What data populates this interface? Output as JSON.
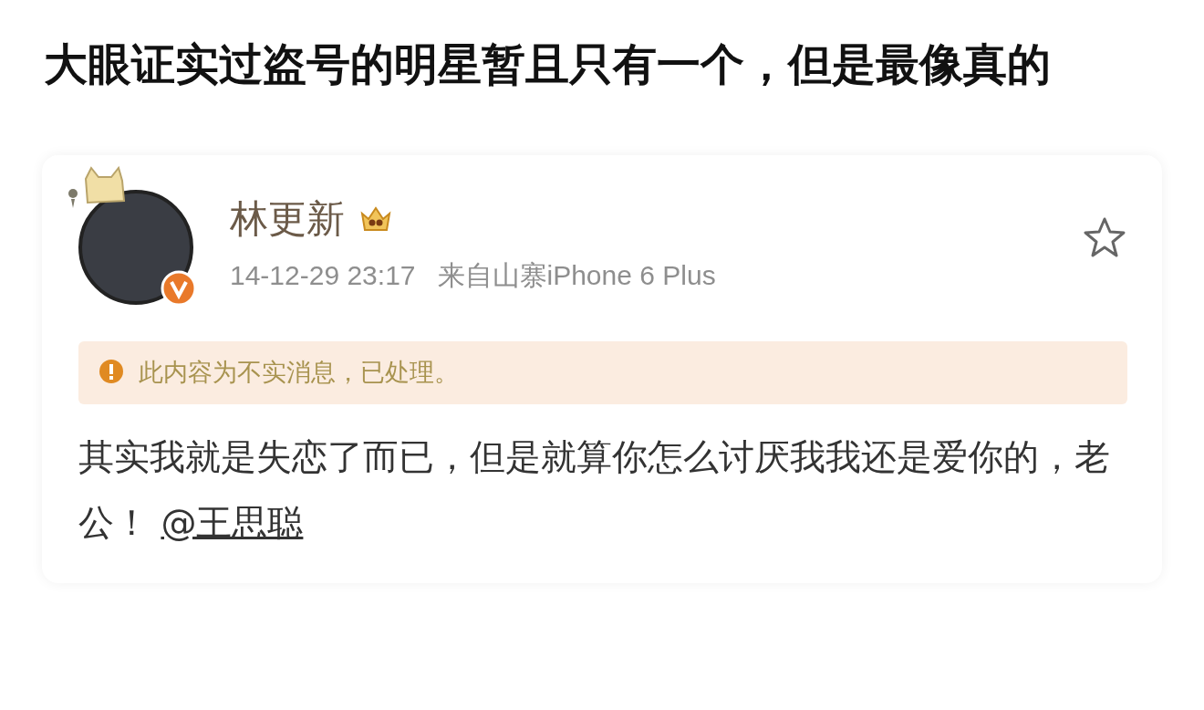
{
  "headline": "大眼证实过盗号的明星暂且只有一个，但是最像真的",
  "post": {
    "author": "林更新",
    "verified": true,
    "vip": true,
    "starred": false,
    "time": "14-12-29 23:17",
    "source": "来自山寨iPhone 6 Plus",
    "notice": "此内容为不实消息，已处理。",
    "body": "其实我就是失恋了而已，但是就算你怎么讨厌我我还是爱你的，老公！",
    "mention": "@王思聪"
  }
}
